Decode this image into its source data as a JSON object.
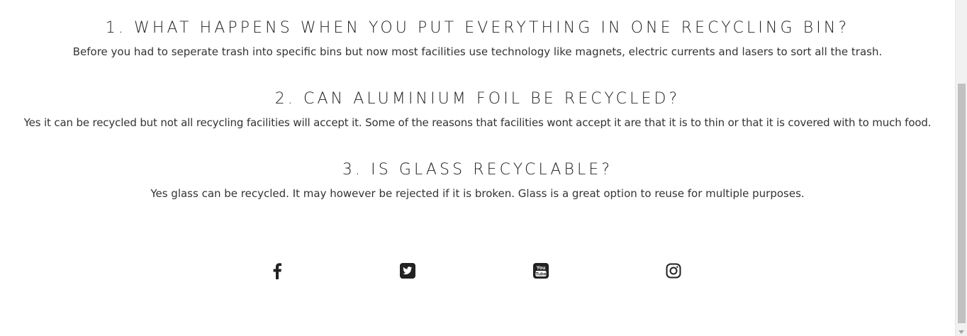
{
  "faq": [
    {
      "question": "1. WHAT HAPPENS WHEN YOU PUT EVERYTHING IN ONE RECYCLING BIN?",
      "answer": "Before you had to seperate trash into specific bins but now most facilities use technology like magnets, electric currents and lasers to sort all the trash."
    },
    {
      "question": "2. CAN ALUMINIUM FOIL BE RECYCLED?",
      "answer": "Yes it can be recycled but not all recycling facilities will accept it. Some of the reasons that facilities wont accept it are that it is to thin or that it is covered with to much food."
    },
    {
      "question": "3. IS GLASS RECYCLABLE?",
      "answer": "Yes glass can be recycled. It may however be rejected if it is broken. Glass is a great option to reuse for multiple purposes."
    }
  ],
  "social": {
    "icons": [
      "facebook-icon",
      "twitter-icon",
      "youtube-icon",
      "instagram-icon"
    ],
    "youtube_text_top": "You",
    "youtube_text_bottom": "Tube",
    "icon_color": "#222222"
  },
  "colors": {
    "heading": "#222222",
    "body_text": "#333333",
    "background": "#ffffff"
  }
}
